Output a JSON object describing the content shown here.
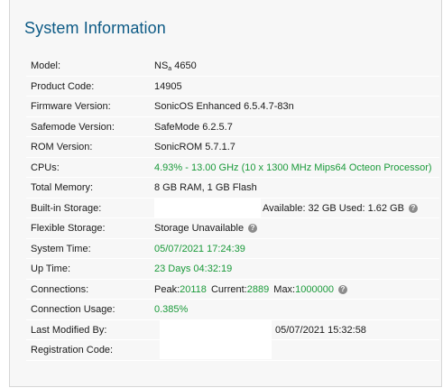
{
  "title": "System Information",
  "rows": {
    "model": {
      "label": "Model:",
      "value": "NS",
      "value_sub": "a",
      "value_rest": " 4650"
    },
    "product_code": {
      "label": "Product Code:",
      "value": "14905"
    },
    "firmware": {
      "label": "Firmware Version:",
      "value": "SonicOS Enhanced 6.5.4.7-83n"
    },
    "safemode": {
      "label": "Safemode Version:",
      "value": "SafeMode 6.2.5.7"
    },
    "rom": {
      "label": "ROM Version:",
      "value": "SonicROM 5.7.1.7"
    },
    "cpus": {
      "label": "CPUs:",
      "value": "4.93% - 13.00 GHz (10 x 1300 MHz Mips64 Octeon Processor)"
    },
    "memory": {
      "label": "Total Memory:",
      "value": "8 GB RAM, 1 GB Flash"
    },
    "storage": {
      "label": "Built-in Storage:",
      "value": "Available: 32 GB Used: 1.62 GB"
    },
    "flexible": {
      "label": "Flexible Storage:",
      "value": "Storage Unavailable"
    },
    "system_time": {
      "label": "System Time:",
      "value": "05/07/2021 17:24:39"
    },
    "uptime": {
      "label": "Up Time:",
      "value": "23 Days 04:32:19"
    },
    "connections": {
      "label": "Connections:",
      "peak_label": "Peak:",
      "peak": "20118",
      "current_label": "Current:",
      "current": "2889",
      "max_label": "Max:",
      "max": "1000000"
    },
    "conn_usage": {
      "label": "Connection Usage:",
      "value": "0.385%"
    },
    "last_modified": {
      "label": "Last Modified By:",
      "value": "05/07/2021 15:32:58"
    },
    "registration": {
      "label": "Registration Code:",
      "value": ""
    }
  },
  "icons": {
    "help": "help-icon"
  },
  "colors": {
    "title": "#0e5b86",
    "status_green": "#1a9a3a"
  }
}
